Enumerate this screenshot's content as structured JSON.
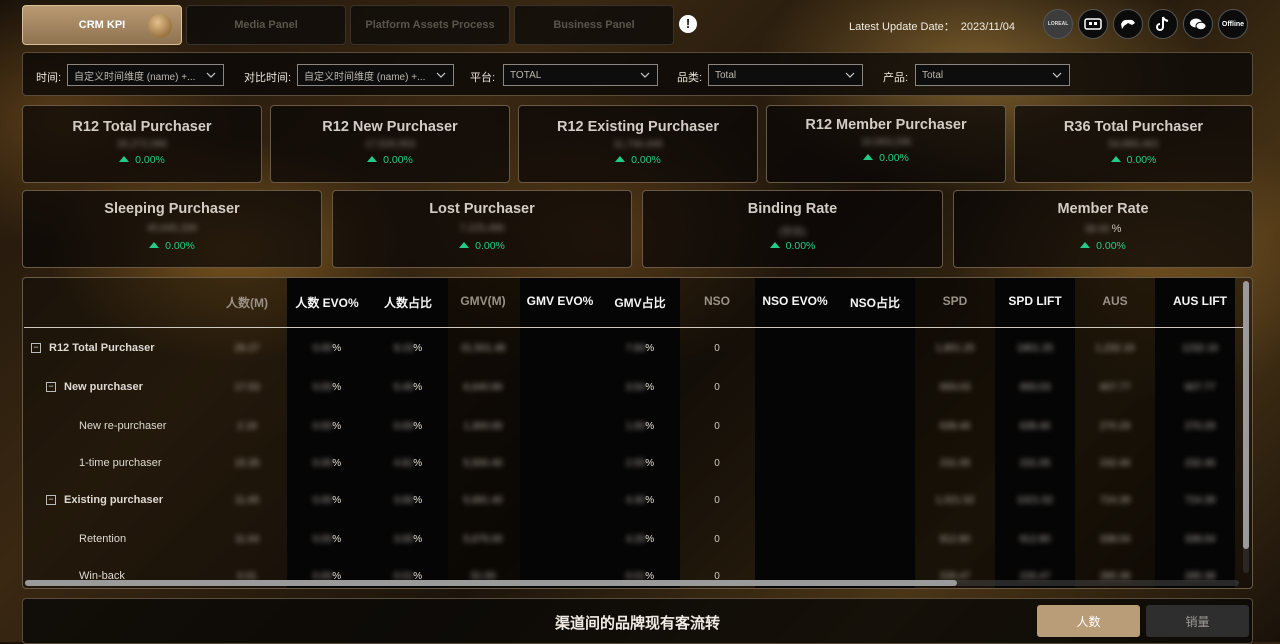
{
  "nav": {
    "tabs": [
      {
        "label": "CRM KPI",
        "active": true
      },
      {
        "label": "Media Panel",
        "active": false
      },
      {
        "label": "Platform Assets Process",
        "active": false
      },
      {
        "label": "Business Panel",
        "active": false
      }
    ]
  },
  "header": {
    "update_label": "Latest Update Date：",
    "update_date": "2023/11/04",
    "channel_icons": [
      {
        "name": "brand-logo-icon",
        "label": "LOREAL"
      },
      {
        "name": "tmall-icon",
        "label": ""
      },
      {
        "name": "jd-icon",
        "label": ""
      },
      {
        "name": "tiktok-icon",
        "label": ""
      },
      {
        "name": "wechat-icon",
        "label": ""
      },
      {
        "name": "offline-icon",
        "label": "Offline"
      }
    ]
  },
  "filters": [
    {
      "label": "时间:",
      "value": "自定义时间维度 (name) +...",
      "placeholder": false
    },
    {
      "label": "对比时间:",
      "value": "自定义时间维度 (name) +...",
      "placeholder": false
    },
    {
      "label": "平台:",
      "value": "TOTAL"
    },
    {
      "label": "品类:",
      "value": "Total"
    },
    {
      "label": "产品:",
      "value": "Total"
    }
  ],
  "kpis_row1": [
    {
      "title": "R12 Total Purchaser",
      "value": "26,272,096",
      "change": "0.00%"
    },
    {
      "title": "R12 New Purchaser",
      "value": "17,526,553",
      "change": "0.00%"
    },
    {
      "title": "R12 Existing Purchaser",
      "value": "11,744,446",
      "change": "0.00%"
    },
    {
      "title": "R12 Member Purchaser",
      "value": "10,003,236",
      "change": "0.00%"
    },
    {
      "title": "R36 Total Purchaser",
      "value": "54,865,462",
      "change": "0.00%"
    }
  ],
  "kpis_row2": [
    {
      "title": "Sleeping Purchaser",
      "value": "40,645,336",
      "change": "0.00%"
    },
    {
      "title": "Lost Purchaser",
      "value": "7,225,486",
      "change": "0.00%"
    },
    {
      "title": "Binding Rate",
      "value": "(空白)",
      "change": "0.00%"
    },
    {
      "title": "Member Rate",
      "value": "38.00",
      "suffix": "%",
      "change": "0.00%"
    }
  ],
  "table": {
    "columns": [
      "人数(M)",
      "人数 EVO%",
      "人数占比",
      "GMV(M)",
      "GMV EVO%",
      "GMV占比",
      "NSO",
      "NSO EVO%",
      "NSO占比",
      "SPD",
      "SPD LIFT",
      "AUS",
      "AUS LIFT"
    ],
    "rows": [
      {
        "label": "R12 Total Purchaser",
        "toggle": "−",
        "bold": true,
        "values": [
          "26.27",
          "0.00",
          "9.19",
          "31,501.48",
          "",
          "7.84",
          "0",
          "",
          "",
          "1,801.25",
          "1801.25",
          "1,232.16",
          "1232.16"
        ]
      },
      {
        "label": "New purchaser",
        "toggle": "−",
        "bold": true,
        "values": [
          "17.53",
          "0.00",
          "5.49",
          "6,640.66",
          "",
          "3.54",
          "0",
          "",
          "",
          "693.03",
          "693.03",
          "607.77",
          "607.77"
        ]
      },
      {
        "label": "New re-purchaser",
        "toggle": "",
        "bold": false,
        "values": [
          "2.19",
          "0.00",
          "0.69",
          "1,300.00",
          "",
          "1.00",
          "0",
          "",
          "",
          "639.46",
          "639.46",
          "270.29",
          "270.29"
        ]
      },
      {
        "label": "1-time purchaser",
        "toggle": "",
        "bold": false,
        "values": [
          "15.35",
          "0.00",
          "4.81",
          "5,500.40",
          "",
          "2.55",
          "0",
          "",
          "",
          "231.05",
          "231.05",
          "232.46",
          "232.46"
        ]
      },
      {
        "label": "Existing purchaser",
        "toggle": "−",
        "bold": true,
        "values": [
          "11.65",
          "0.00",
          "3.66",
          "5,681.40",
          "",
          "4.30",
          "0",
          "",
          "",
          "1,021.52",
          "1021.52",
          "724.39",
          "724.39"
        ]
      },
      {
        "label": "Retention",
        "toggle": "",
        "bold": false,
        "values": [
          "11.64",
          "0.00",
          "3.65",
          "5,675.00",
          "",
          "4.29",
          "0",
          "",
          "",
          "912.80",
          "912.80",
          "338.04",
          "338.04"
        ]
      },
      {
        "label": "Win-back",
        "toggle": "",
        "bold": false,
        "values": [
          "0.01",
          "0.00",
          "0.01",
          "31.00",
          "",
          "0.01",
          "0",
          "",
          "",
          "226.47",
          "226.47",
          "285.38",
          "285.38"
        ]
      }
    ]
  },
  "bottom": {
    "title": "渠道间的品牌现有客流转",
    "toggles": [
      {
        "label": "人数",
        "active": true
      },
      {
        "label": "销量",
        "active": false
      }
    ]
  }
}
